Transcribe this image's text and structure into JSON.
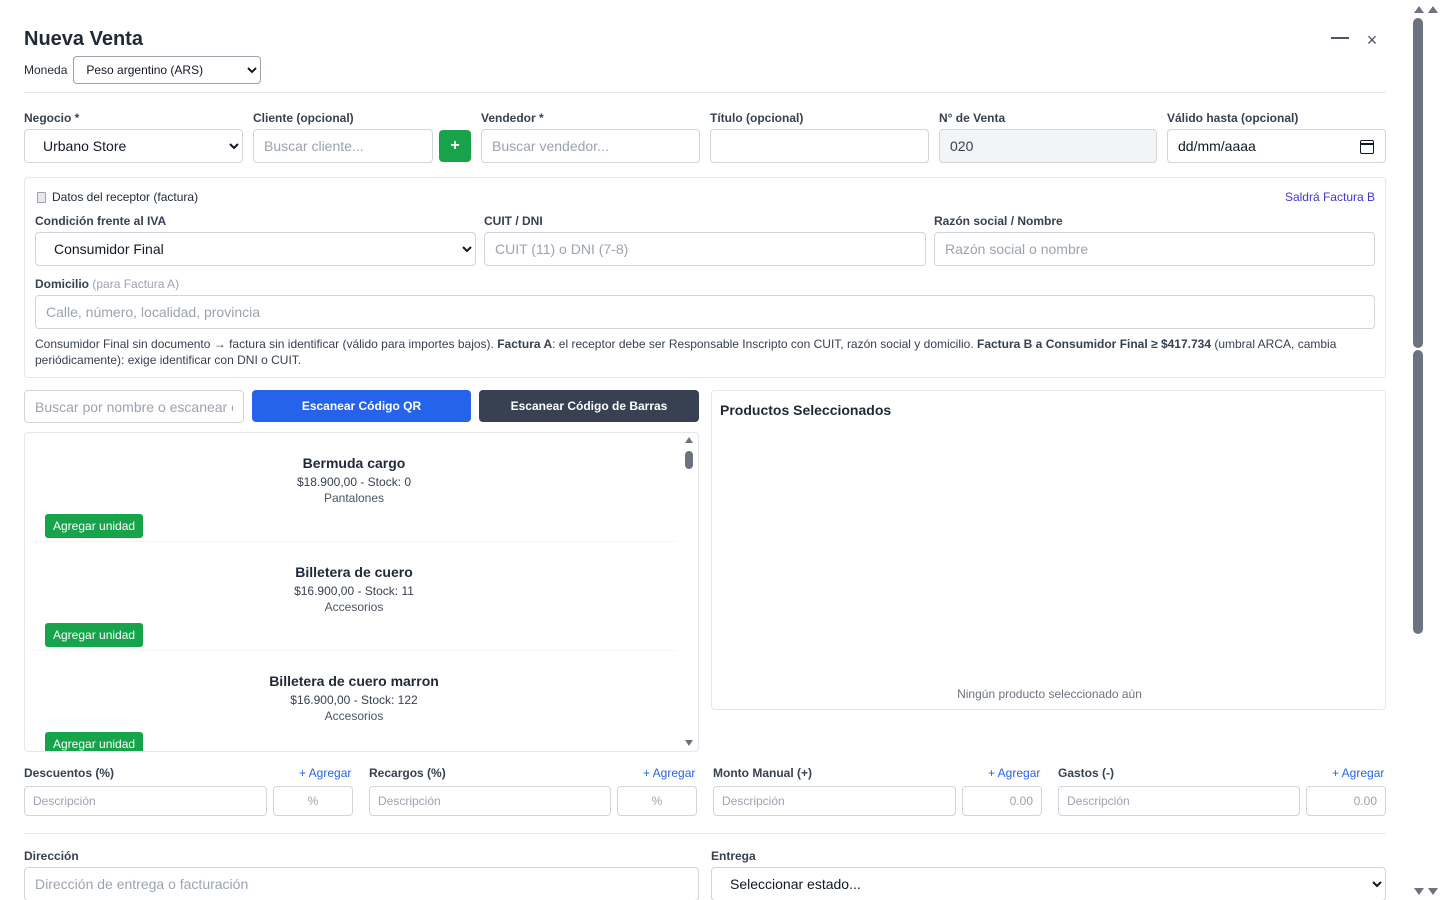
{
  "header": {
    "title": "Nueva Venta",
    "minimize_label": "",
    "close_label": "×",
    "moneda_label": "Moneda",
    "moneda_value": "Peso argentino (ARS)"
  },
  "form": {
    "negocio": {
      "label": "Negocio *",
      "value": "Urbano Store"
    },
    "cliente": {
      "label": "Cliente (opcional)",
      "placeholder": "Buscar cliente...",
      "add_label": "+"
    },
    "vendedor": {
      "label": "Vendedor *",
      "placeholder": "Buscar vendedor..."
    },
    "titulo": {
      "label": "Título (opcional)",
      "value": ""
    },
    "numero": {
      "label": "N° de Venta",
      "value": "020"
    },
    "valido": {
      "label": "Válido hasta (opcional)",
      "value": "dd/mm/aaaa"
    }
  },
  "receptor": {
    "title": "Datos del receptor (factura)",
    "badge": "Saldrá Factura B",
    "condicion": {
      "label": "Condición frente al IVA",
      "value": "Consumidor Final"
    },
    "cuit": {
      "label": "CUIT / DNI",
      "placeholder": "CUIT (11) o DNI (7-8)"
    },
    "razon": {
      "label": "Razón social / Nombre",
      "placeholder": "Razón social o nombre"
    },
    "domicilio": {
      "label": "Domicilio",
      "label_hint": "(para Factura A)",
      "placeholder": "Calle, número, localidad, provincia"
    },
    "note": {
      "p1": "Consumidor Final sin documento → factura sin identificar (válido para importes bajos). ",
      "b1": "Factura A",
      "p2": ": el receptor debe ser Responsable Inscripto con CUIT, razón social y domicilio. ",
      "b2": "Factura B a Consumidor Final ≥ $417.734",
      "p3": " (umbral ARCA, cambia periódicamente): exige identificar con DNI o CUIT."
    }
  },
  "search": {
    "placeholder": "Buscar por nombre o escanear c",
    "qr_label": "Escanear Código QR",
    "barcode_label": "Escanear Código de Barras"
  },
  "products": [
    {
      "name": "Bermuda cargo",
      "price": "$18.900,00 - Stock: 0",
      "category": "Pantalones",
      "add_label": "Agregar unidad"
    },
    {
      "name": "Billetera de cuero",
      "price": "$16.900,00 - Stock: 11",
      "category": "Accesorios",
      "add_label": "Agregar unidad"
    },
    {
      "name": "Billetera de cuero marron",
      "price": "$16.900,00 - Stock: 122",
      "category": "Accesorios",
      "add_label": "Agregar unidad"
    }
  ],
  "selected": {
    "title": "Productos Seleccionados",
    "empty": "Ningún producto seleccionado aún"
  },
  "adjustments": [
    {
      "label": "Descuentos (%)",
      "add": "+ Agregar",
      "desc_placeholder": "Descripción",
      "value_placeholder": "%"
    },
    {
      "label": "Recargos (%)",
      "add": "+ Agregar",
      "desc_placeholder": "Descripción",
      "value_placeholder": "%"
    },
    {
      "label": "Monto Manual (+)",
      "add": "+ Agregar",
      "desc_placeholder": "Descripción",
      "value_placeholder": "0.00"
    },
    {
      "label": "Gastos (-)",
      "add": "+ Agregar",
      "desc_placeholder": "Descripción",
      "value_placeholder": "0.00"
    }
  ],
  "bottom": {
    "direccion": {
      "label": "Dirección",
      "placeholder": "Dirección de entrega o facturación"
    },
    "entrega": {
      "label": "Entrega",
      "value": "Seleccionar estado..."
    }
  },
  "colors": {
    "primary_blue": "#2563eb",
    "success_green": "#16a34a",
    "dark_button": "#374151",
    "badge_indigo": "#4338ca"
  }
}
